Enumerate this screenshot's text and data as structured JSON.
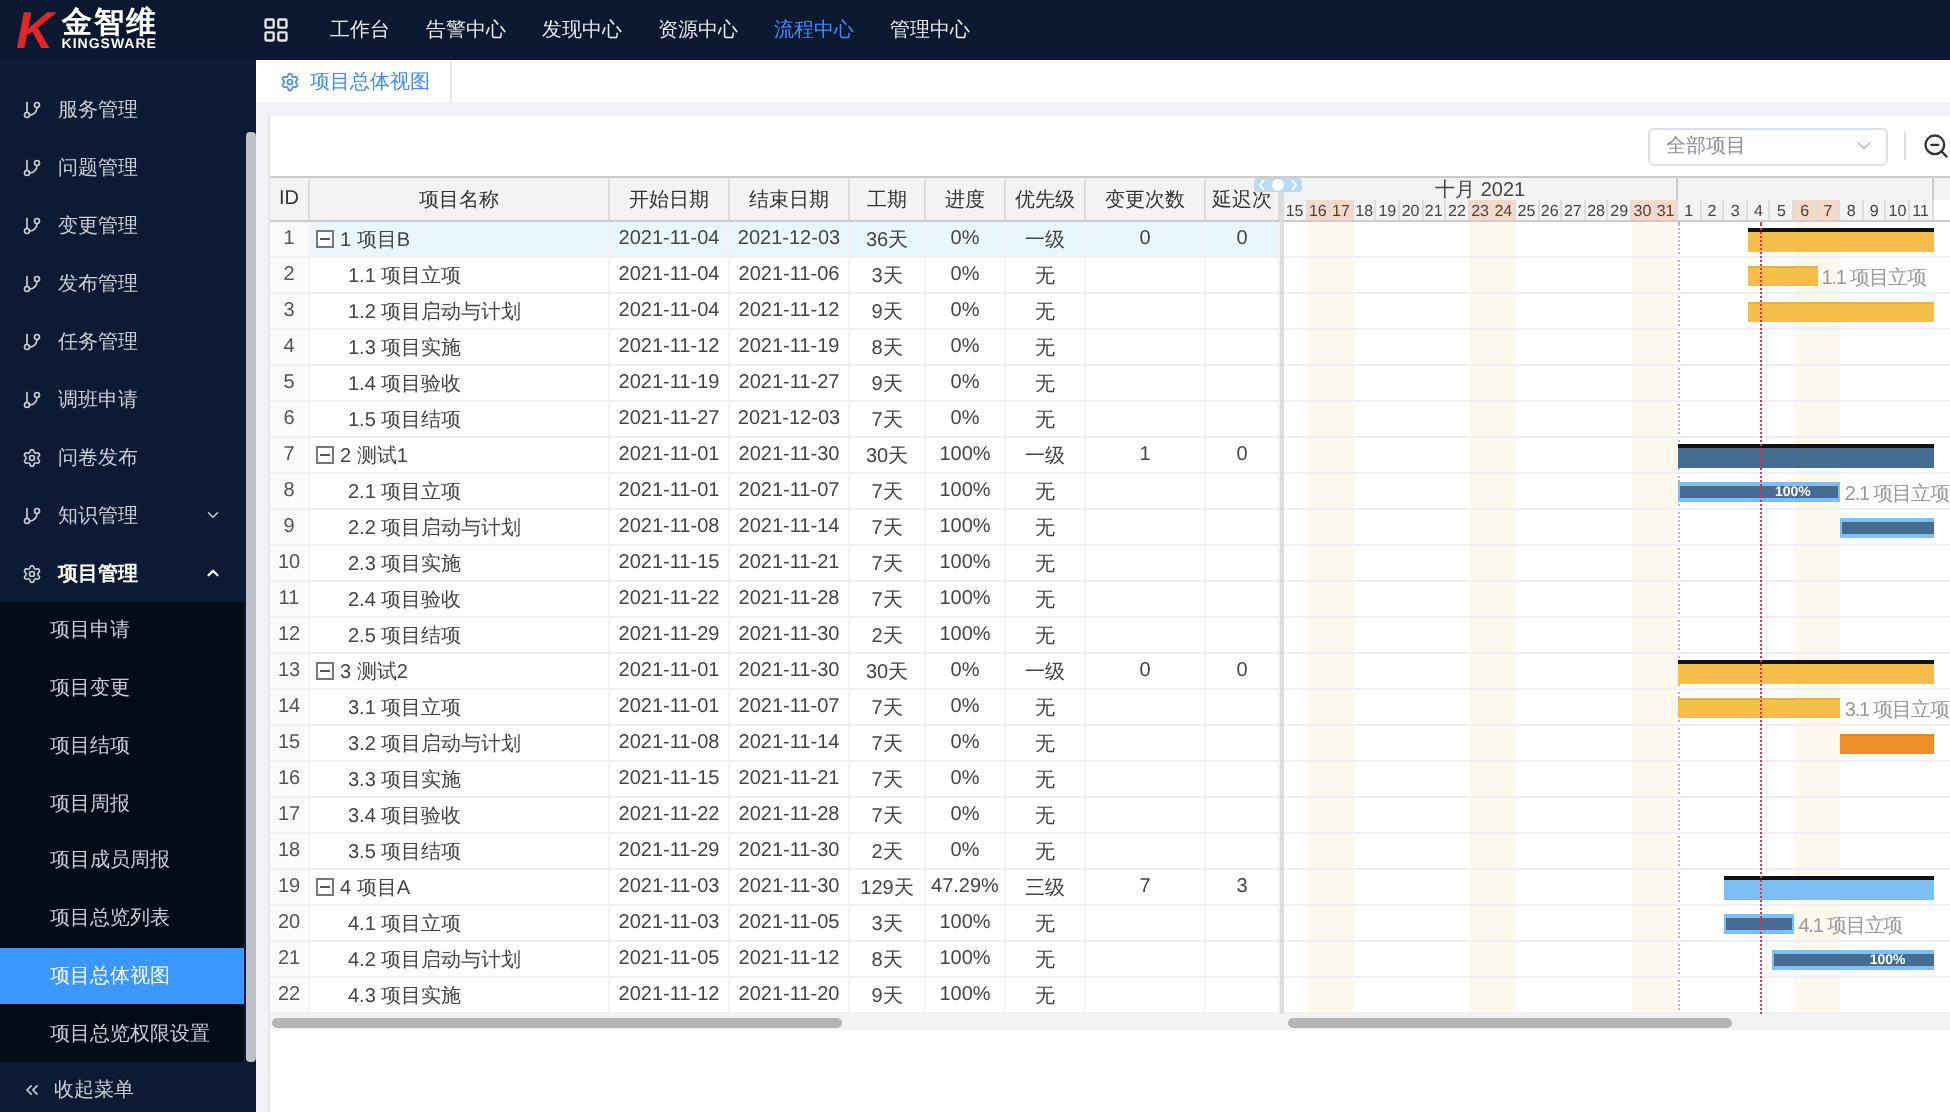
{
  "logo": {
    "mark": "K",
    "name": "金智维",
    "sub": "KINGSWARE"
  },
  "nav": [
    {
      "label": "工作台",
      "selected": false
    },
    {
      "label": "告警中心",
      "selected": false
    },
    {
      "label": "发现中心",
      "selected": false
    },
    {
      "label": "资源中心",
      "selected": false
    },
    {
      "label": "流程中心",
      "selected": true
    },
    {
      "label": "管理中心",
      "selected": false
    }
  ],
  "sidebar": {
    "items": [
      {
        "label": "服务管理",
        "kind": "branch"
      },
      {
        "label": "问题管理",
        "kind": "branch"
      },
      {
        "label": "变更管理",
        "kind": "branch"
      },
      {
        "label": "发布管理",
        "kind": "branch"
      },
      {
        "label": "任务管理",
        "kind": "branch"
      },
      {
        "label": "调班申请",
        "kind": "branch"
      },
      {
        "label": "问卷发布",
        "kind": "gear"
      },
      {
        "label": "知识管理",
        "kind": "branch",
        "expanded": false
      },
      {
        "label": "项目管理",
        "kind": "gear",
        "expanded": true,
        "children": [
          {
            "label": "项目申请",
            "selected": false
          },
          {
            "label": "项目变更",
            "selected": false
          },
          {
            "label": "项目结项",
            "selected": false
          },
          {
            "label": "项目周报",
            "selected": false
          },
          {
            "label": "项目成员周报",
            "selected": false
          },
          {
            "label": "项目总览列表",
            "selected": false
          },
          {
            "label": "项目总体视图",
            "selected": true
          },
          {
            "label": "项目总览权限设置",
            "selected": false
          }
        ]
      }
    ],
    "collapse": "收起菜单"
  },
  "tabs": [
    {
      "label": "项目总体视图",
      "selected": true
    }
  ],
  "filter": {
    "value": "全部项目"
  },
  "table": {
    "columns": [
      "ID",
      "项目名称",
      "开始日期",
      "结束日期",
      "工期",
      "进度",
      "优先级",
      "变更次数",
      "延迟次"
    ],
    "rows": [
      {
        "id": "1",
        "name": "1 项目B",
        "start": "2021-11-04",
        "end": "2021-12-03",
        "duration": "36天",
        "progress": "0%",
        "priority": "一级",
        "changes": "0",
        "delays": "0",
        "selected": true,
        "expanded": true,
        "bar": {
          "kind": "summary",
          "color": "#f4be48"
        },
        "children": [
          {
            "id": "2",
            "name": "1.1 项目立项",
            "start": "2021-11-04",
            "end": "2021-11-06",
            "duration": "3天",
            "progress": "0%",
            "priority": "无",
            "selected": false,
            "bar": {
              "kind": "task",
              "color": "#f4be48",
              "label": "1.1 项目立项"
            }
          },
          {
            "id": "3",
            "name": "1.2 项目启动与计划",
            "start": "2021-11-04",
            "end": "2021-11-12",
            "duration": "9天",
            "progress": "0%",
            "priority": "无",
            "selected": false,
            "bar": {
              "kind": "task",
              "color": "#f4be48"
            }
          },
          {
            "id": "4",
            "name": "1.3 项目实施",
            "start": "2021-11-12",
            "end": "2021-11-19",
            "duration": "8天",
            "progress": "0%",
            "priority": "无",
            "selected": false
          },
          {
            "id": "5",
            "name": "1.4 项目验收",
            "start": "2021-11-19",
            "end": "2021-11-27",
            "duration": "9天",
            "progress": "0%",
            "priority": "无",
            "selected": false
          },
          {
            "id": "6",
            "name": "1.5 项目结项",
            "start": "2021-11-27",
            "end": "2021-12-03",
            "duration": "7天",
            "progress": "0%",
            "priority": "无",
            "selected": false
          }
        ]
      },
      {
        "id": "7",
        "name": "2 测试1",
        "start": "2021-11-01",
        "end": "2021-11-30",
        "duration": "30天",
        "progress": "100%",
        "priority": "一级",
        "changes": "1",
        "delays": "0",
        "selected": false,
        "expanded": true,
        "bar": {
          "kind": "summary",
          "color": "#466d91"
        },
        "children": [
          {
            "id": "8",
            "name": "2.1 项目立项",
            "start": "2021-11-01",
            "end": "2021-11-07",
            "duration": "7天",
            "progress": "100%",
            "priority": "无",
            "selected": false,
            "bar": {
              "kind": "done",
              "color": "#466d91",
              "text": "100%",
              "label": "2.1 项目立项"
            }
          },
          {
            "id": "9",
            "name": "2.2 项目启动与计划",
            "start": "2021-11-08",
            "end": "2021-11-14",
            "duration": "7天",
            "progress": "100%",
            "priority": "无",
            "selected": false,
            "bar": {
              "kind": "done",
              "color": "#466d91"
            }
          },
          {
            "id": "10",
            "name": "2.3 项目实施",
            "start": "2021-11-15",
            "end": "2021-11-21",
            "duration": "7天",
            "progress": "100%",
            "priority": "无",
            "selected": false
          },
          {
            "id": "11",
            "name": "2.4 项目验收",
            "start": "2021-11-22",
            "end": "2021-11-28",
            "duration": "7天",
            "progress": "100%",
            "priority": "无",
            "selected": false
          },
          {
            "id": "12",
            "name": "2.5 项目结项",
            "start": "2021-11-29",
            "end": "2021-11-30",
            "duration": "2天",
            "progress": "100%",
            "priority": "无",
            "selected": false
          }
        ]
      },
      {
        "id": "13",
        "name": "3 测试2",
        "start": "2021-11-01",
        "end": "2021-11-30",
        "duration": "30天",
        "progress": "0%",
        "priority": "一级",
        "changes": "0",
        "delays": "0",
        "selected": false,
        "expanded": true,
        "bar": {
          "kind": "summary",
          "color": "#f4be48"
        },
        "children": [
          {
            "id": "14",
            "name": "3.1 项目立项",
            "start": "2021-11-01",
            "end": "2021-11-07",
            "duration": "7天",
            "progress": "0%",
            "priority": "无",
            "selected": false,
            "bar": {
              "kind": "task",
              "color": "#f4be48",
              "label": "3.1 项目立项"
            }
          },
          {
            "id": "15",
            "name": "3.2 项目启动与计划",
            "start": "2021-11-08",
            "end": "2021-11-14",
            "duration": "7天",
            "progress": "0%",
            "priority": "无",
            "selected": false,
            "bar": {
              "kind": "task",
              "color": "#ef8f27"
            }
          },
          {
            "id": "16",
            "name": "3.3 项目实施",
            "start": "2021-11-15",
            "end": "2021-11-21",
            "duration": "7天",
            "progress": "0%",
            "priority": "无",
            "selected": false
          },
          {
            "id": "17",
            "name": "3.4 项目验收",
            "start": "2021-11-22",
            "end": "2021-11-28",
            "duration": "7天",
            "progress": "0%",
            "priority": "无",
            "selected": false
          },
          {
            "id": "18",
            "name": "3.5 项目结项",
            "start": "2021-11-29",
            "end": "2021-11-30",
            "duration": "2天",
            "progress": "0%",
            "priority": "无",
            "selected": false
          }
        ]
      },
      {
        "id": "19",
        "name": "4 项目A",
        "start": "2021-11-03",
        "end": "2021-11-30",
        "duration": "129天",
        "progress": "47.29%",
        "priority": "三级",
        "changes": "7",
        "delays": "3",
        "selected": false,
        "expanded": true,
        "bar": {
          "kind": "summary",
          "color": "#7cbff5"
        },
        "children": [
          {
            "id": "20",
            "name": "4.1 项目立项",
            "start": "2021-11-03",
            "end": "2021-11-05",
            "duration": "3天",
            "progress": "100%",
            "priority": "无",
            "selected": false,
            "bar": {
              "kind": "done",
              "color": "#466d91",
              "label": "4.1 项目立项"
            }
          },
          {
            "id": "21",
            "name": "4.2 项目启动与计划",
            "start": "2021-11-05",
            "end": "2021-11-12",
            "duration": "8天",
            "progress": "100%",
            "priority": "无",
            "selected": false,
            "bar": {
              "kind": "done",
              "color": "#466d91",
              "text": "100%"
            }
          },
          {
            "id": "22",
            "name": "4.3 项目实施",
            "start": "2021-11-12",
            "end": "2021-11-20",
            "duration": "9天",
            "progress": "100%",
            "priority": "无",
            "selected": false
          }
        ]
      }
    ]
  },
  "gantt": {
    "months": [
      {
        "label": "十月 2021",
        "days": [
          {
            "label": "15",
            "weekend": false,
            "today": false
          },
          {
            "label": "16",
            "weekend": true,
            "today": false
          },
          {
            "label": "17",
            "weekend": true,
            "today": false
          },
          {
            "label": "18",
            "weekend": false,
            "today": false
          },
          {
            "label": "19",
            "weekend": false,
            "today": false
          },
          {
            "label": "20",
            "weekend": false,
            "today": false
          },
          {
            "label": "21",
            "weekend": false,
            "today": false
          },
          {
            "label": "22",
            "weekend": false,
            "today": false
          },
          {
            "label": "23",
            "weekend": true,
            "today": false
          },
          {
            "label": "24",
            "weekend": true,
            "today": false
          },
          {
            "label": "25",
            "weekend": false,
            "today": false
          },
          {
            "label": "26",
            "weekend": false,
            "today": false
          },
          {
            "label": "27",
            "weekend": false,
            "today": false
          },
          {
            "label": "28",
            "weekend": false,
            "today": false
          },
          {
            "label": "29",
            "weekend": false,
            "today": false
          },
          {
            "label": "30",
            "weekend": true,
            "today": false
          },
          {
            "label": "31",
            "weekend": true,
            "today": false
          }
        ]
      },
      {
        "days": [
          {
            "label": "1",
            "weekend": false,
            "today": false
          },
          {
            "label": "2",
            "weekend": false,
            "today": false
          },
          {
            "label": "3",
            "weekend": false,
            "today": false
          },
          {
            "label": "4",
            "weekend": false,
            "today": true
          },
          {
            "label": "5",
            "weekend": false,
            "today": false
          },
          {
            "label": "6",
            "weekend": true,
            "today": false
          },
          {
            "label": "7",
            "weekend": true,
            "today": false
          },
          {
            "label": "8",
            "weekend": false,
            "today": false
          },
          {
            "label": "9",
            "weekend": false,
            "today": false
          },
          {
            "label": "10",
            "weekend": false,
            "today": false
          },
          {
            "label": "11",
            "weekend": false,
            "today": false
          }
        ]
      }
    ]
  }
}
